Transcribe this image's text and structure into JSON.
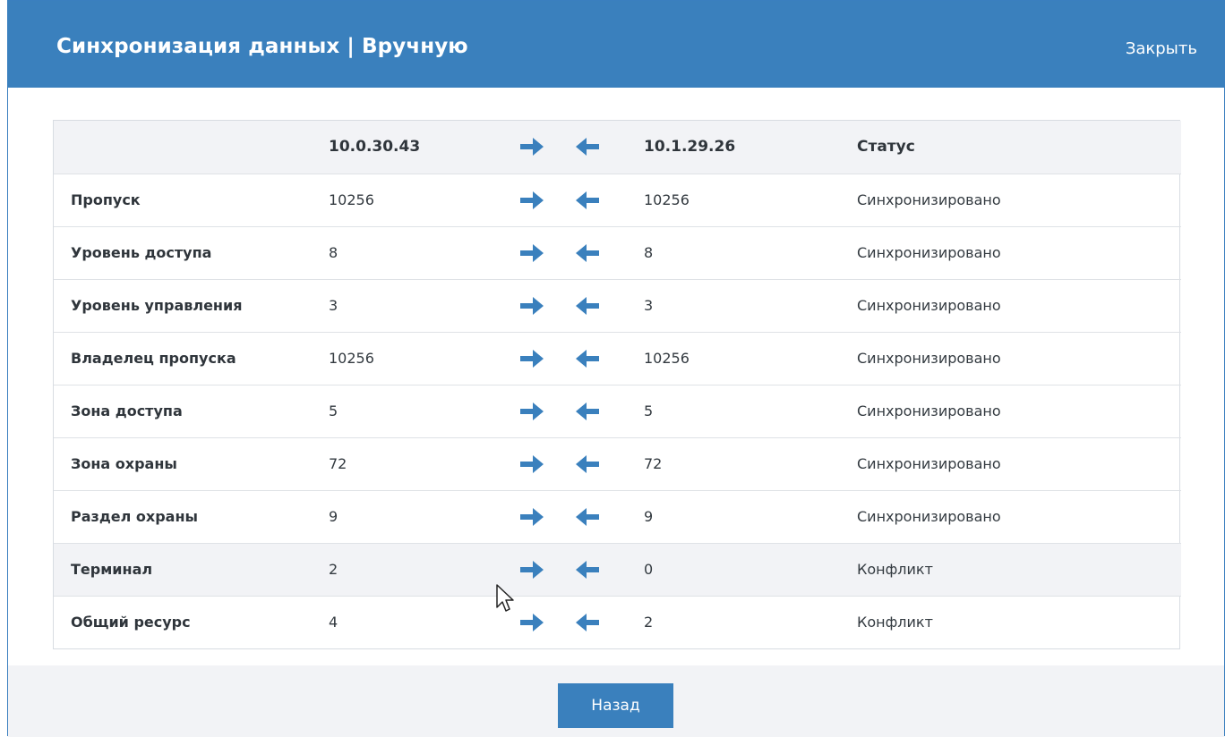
{
  "header": {
    "title": "Синхронизация данных | Вручную",
    "close_label": "Закрыть"
  },
  "table": {
    "columns": {
      "left_host": "10.0.30.43",
      "right_host": "10.1.29.26",
      "status": "Статус"
    },
    "rows": [
      {
        "name": "Пропуск",
        "left": "10256",
        "right": "10256",
        "status": "Синхронизировано"
      },
      {
        "name": "Уровень доступа",
        "left": "8",
        "right": "8",
        "status": "Синхронизировано"
      },
      {
        "name": "Уровень управления",
        "left": "3",
        "right": "3",
        "status": "Синхронизировано"
      },
      {
        "name": "Владелец пропуска",
        "left": "10256",
        "right": "10256",
        "status": "Синхронизировано"
      },
      {
        "name": "Зона доступа",
        "left": "5",
        "right": "5",
        "status": "Синхронизировано"
      },
      {
        "name": "Зона охраны",
        "left": "72",
        "right": "72",
        "status": "Синхронизировано"
      },
      {
        "name": "Раздел охраны",
        "left": "9",
        "right": "9",
        "status": "Синхронизировано"
      },
      {
        "name": "Терминал",
        "left": "2",
        "right": "0",
        "status": "Конфликт"
      },
      {
        "name": "Общий ресурс",
        "left": "4",
        "right": "2",
        "status": "Конфликт"
      }
    ]
  },
  "icons": {
    "sync_right": "arrow-right-icon",
    "sync_left": "arrow-left-icon"
  },
  "footer": {
    "back_label": "Назад"
  },
  "colors": {
    "accent": "#3a80bd",
    "row_highlight": "#f2f3f6"
  }
}
